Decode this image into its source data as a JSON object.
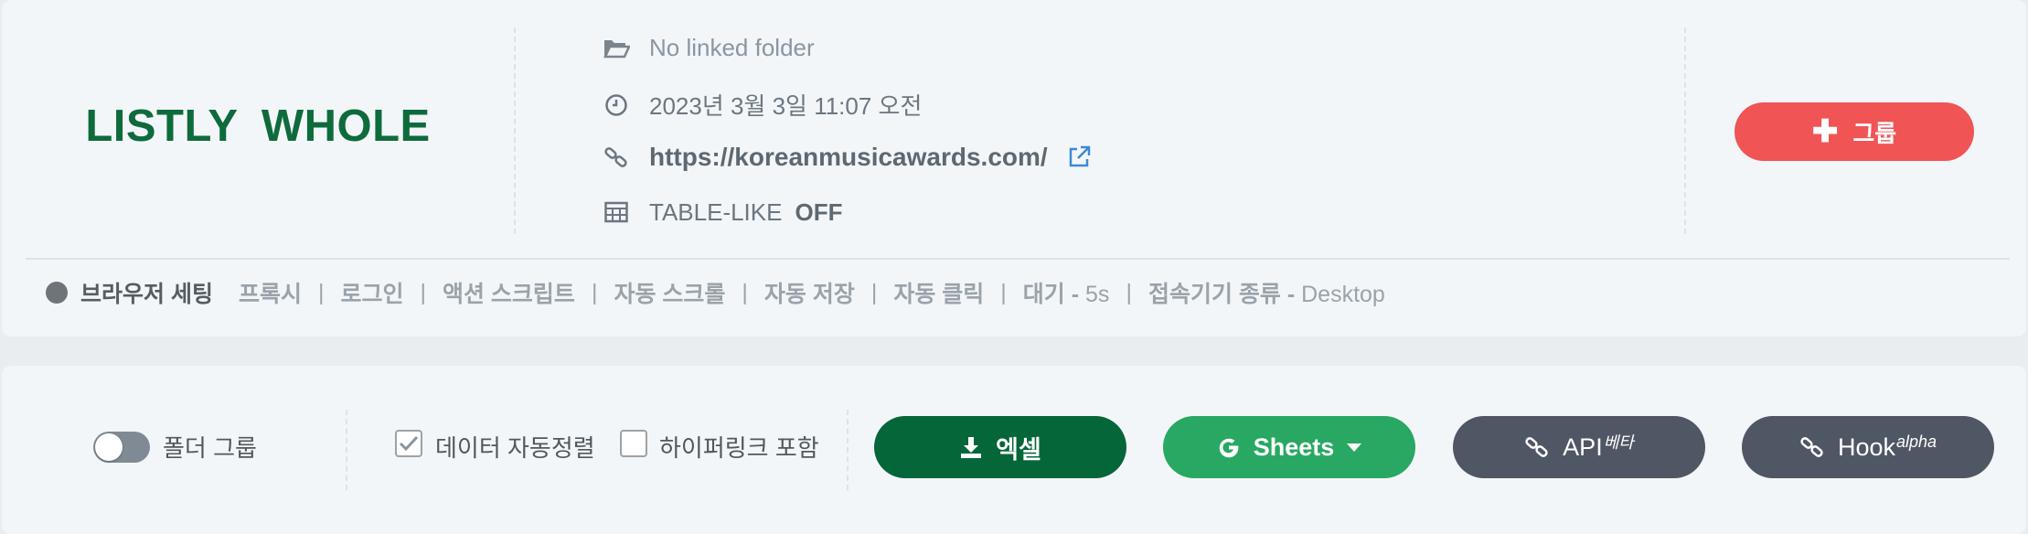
{
  "header": {
    "title": "LISTLY  WHOLE",
    "folder": "No linked folder",
    "datetime": "2023년 3월 3일 11:07 오전",
    "url": "https://koreanmusicawards.com/",
    "table_like_label": "TABLE-LIKE",
    "table_like_value": "OFF",
    "group_button": "그룹",
    "group_button_color": "#f05455"
  },
  "browser_settings": {
    "label": "브라우저 세팅",
    "items": [
      "프록시",
      "로그인",
      "액션 스크립트",
      "자동 스크롤",
      "자동 저장",
      "자동 클릭"
    ],
    "wait_label": "대기 -",
    "wait_value": "5s",
    "device_label": "접속기기 종류 -",
    "device_value": "Desktop"
  },
  "toolbar": {
    "folder_group_label": "폴더 그룹",
    "auto_align_label": "데이터 자동정렬",
    "auto_align_checked": true,
    "include_hyperlink_label": "하이퍼링크 포함",
    "include_hyperlink_checked": false,
    "excel_label": "엑셀",
    "sheets_label": "Sheets",
    "api_label": "API",
    "api_badge": "베타",
    "hook_label": "Hook",
    "hook_badge": "alpha",
    "colors": {
      "excel": "#05663a",
      "sheets": "#28a862",
      "api": "#4f5664",
      "hook": "#4f5664"
    }
  }
}
